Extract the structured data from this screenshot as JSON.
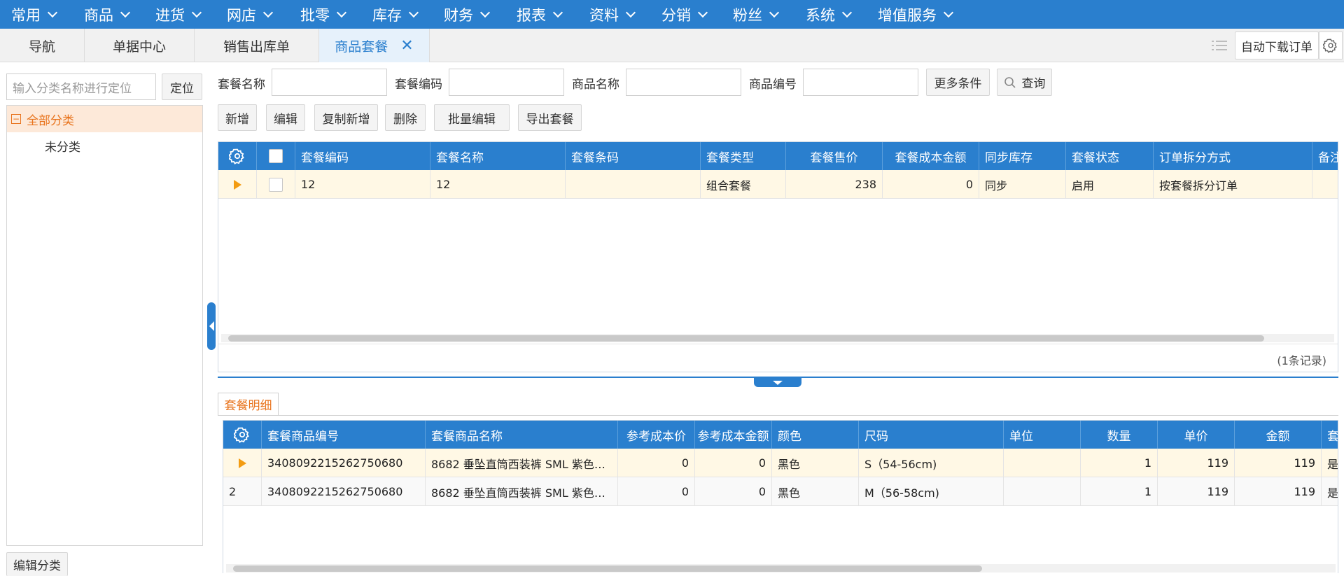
{
  "topnav": {
    "items": [
      {
        "label": "常用"
      },
      {
        "label": "商品"
      },
      {
        "label": "进货"
      },
      {
        "label": "网店"
      },
      {
        "label": "批零"
      },
      {
        "label": "库存"
      },
      {
        "label": "财务"
      },
      {
        "label": "报表"
      },
      {
        "label": "资料"
      },
      {
        "label": "分销"
      },
      {
        "label": "粉丝"
      },
      {
        "label": "系统"
      },
      {
        "label": "增值服务"
      }
    ]
  },
  "tabs": {
    "items": [
      {
        "label": "导航"
      },
      {
        "label": "单据中心"
      },
      {
        "label": "销售出库单"
      },
      {
        "label": "商品套餐",
        "close": "✕"
      }
    ],
    "auto_download": "自动下载订单"
  },
  "sidebar": {
    "search_placeholder": "输入分类名称进行定位",
    "locate_button": "定位",
    "tree_root_toggle": "−",
    "tree_root": "全部分类",
    "tree_child": "未分类",
    "edit_button": "编辑分类"
  },
  "filters": {
    "package_name_label": "套餐名称",
    "package_code_label": "套餐编码",
    "product_name_label": "商品名称",
    "product_code_label": "商品编号",
    "more_conditions": "更多条件",
    "query": "查询"
  },
  "toolbar": {
    "new": "新增",
    "edit": "编辑",
    "copy_new": "复制新增",
    "delete": "删除",
    "batch_edit": "批量编辑",
    "export": "导出套餐"
  },
  "main_grid": {
    "columns": [
      "套餐编码",
      "套餐名称",
      "套餐条码",
      "套餐类型",
      "套餐售价",
      "套餐成本金额",
      "同步库存",
      "套餐状态",
      "订单拆分方式",
      "备注"
    ],
    "rows": [
      {
        "code": "12",
        "name": "12",
        "barcode": "",
        "type": "组合套餐",
        "price": "238",
        "cost": "0",
        "sync": "同步",
        "status": "启用",
        "split": "按套餐拆分订单",
        "remark": ""
      }
    ],
    "record_count": "(1条记录)"
  },
  "detail": {
    "tab_label": "套餐明细",
    "columns": [
      "套餐商品编号",
      "套餐商品名称",
      "参考成本价",
      "参考成本金额",
      "颜色",
      "尺码",
      "单位",
      "数量",
      "单价",
      "金额",
      "套"
    ],
    "rows": [
      {
        "index": "",
        "code": "3408092215262750680",
        "name": "8682 垂坠直筒西装裤 SML 紫色…",
        "ref_cost": "0",
        "ref_amount": "0",
        "color": "黑色",
        "size": "S（54-56cm)",
        "unit": "",
        "qty": "1",
        "unit_price": "119",
        "amount": "119",
        "extra": "是"
      },
      {
        "index": "2",
        "code": "3408092215262750680",
        "name": "8682 垂坠直筒西装裤 SML 紫色…",
        "ref_cost": "0",
        "ref_amount": "0",
        "color": "黑色",
        "size": "M（56-58cm)",
        "unit": "",
        "qty": "1",
        "unit_price": "119",
        "amount": "119",
        "extra": "是"
      }
    ]
  },
  "colors": {
    "primary": "#2a7fce",
    "accent": "#e8731c",
    "row_selected": "#fff8e5"
  },
  "icons": [
    "chevron-down-icon",
    "close-icon",
    "list-icon",
    "gear-icon",
    "search-icon",
    "collapse-left-icon",
    "collapse-down-icon",
    "row-pointer-icon",
    "minus-box-icon"
  ]
}
